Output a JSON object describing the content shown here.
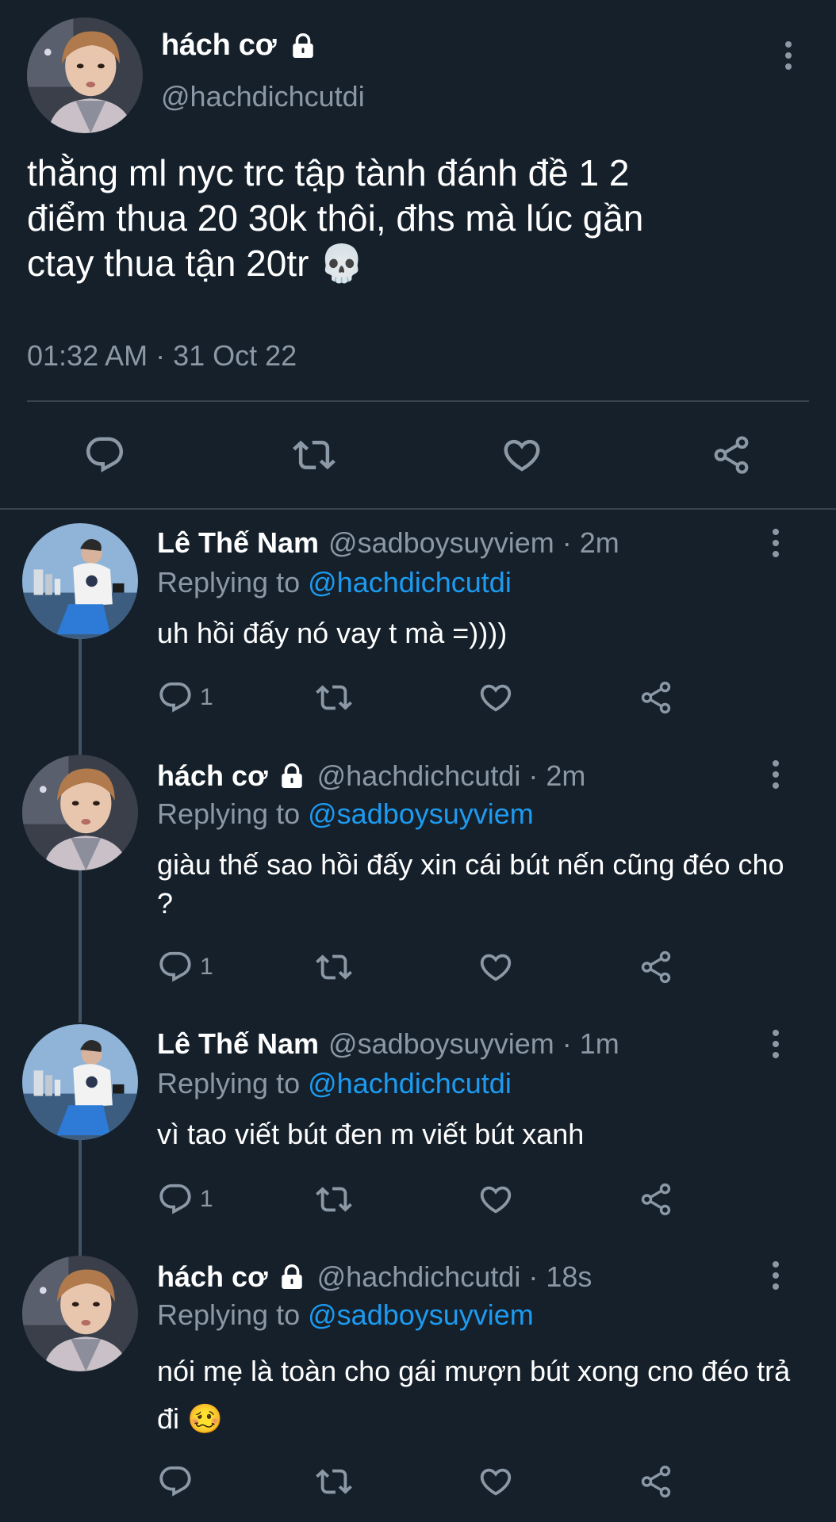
{
  "main_tweet": {
    "name": "hách cơ",
    "handle": "@hachdichcutdi",
    "text": "thằng ml nyc trc tập tành đánh đề 1 2\nđiểm thua 20 30k thôi, đhs mà lúc gần\nctay thua tận 20tr 💀",
    "meta": "01:32 AM · 31 Oct 22",
    "icons": [
      "lock-icon",
      "more-icon",
      "reply-icon",
      "retweet-icon",
      "like-icon",
      "share-icon"
    ]
  },
  "replies": [
    {
      "name": "Lê Thế Nam",
      "locked": false,
      "handle_time": "@sadboysuyviem · 2m",
      "replying_prefix": "Replying to",
      "replying_to": "@hachdichcutdi",
      "text": "uh hồi đấy nó vay t mà =))))",
      "reply_count": "1"
    },
    {
      "name": "hách cơ",
      "locked": true,
      "handle_time": "@hachdichcutdi · 2m",
      "replying_prefix": "Replying to",
      "replying_to": "@sadboysuyviem",
      "text": "giàu thế sao hồi đấy xin cái bút nến cũng đéo cho ?",
      "reply_count": "1"
    },
    {
      "name": "Lê Thế Nam",
      "locked": false,
      "handle_time": "@sadboysuyviem · 1m",
      "replying_prefix": "Replying to",
      "replying_to": "@hachdichcutdi",
      "text": "vì tao viết bút đen m viết bút xanh",
      "reply_count": "1"
    },
    {
      "name": "hách cơ",
      "locked": true,
      "handle_time": "@hachdichcutdi · 18s",
      "replying_prefix": "Replying to",
      "replying_to": "@sadboysuyviem",
      "text": "nói mẹ là toàn cho gái mượn bút xong cno đéo trả đi 🥴",
      "reply_count": ""
    }
  ],
  "colors": {
    "background": "#15202b",
    "text_primary": "#ffffff",
    "text_secondary": "#8b98a5",
    "mention": "#1d9bf0",
    "divider": "#38444d"
  }
}
